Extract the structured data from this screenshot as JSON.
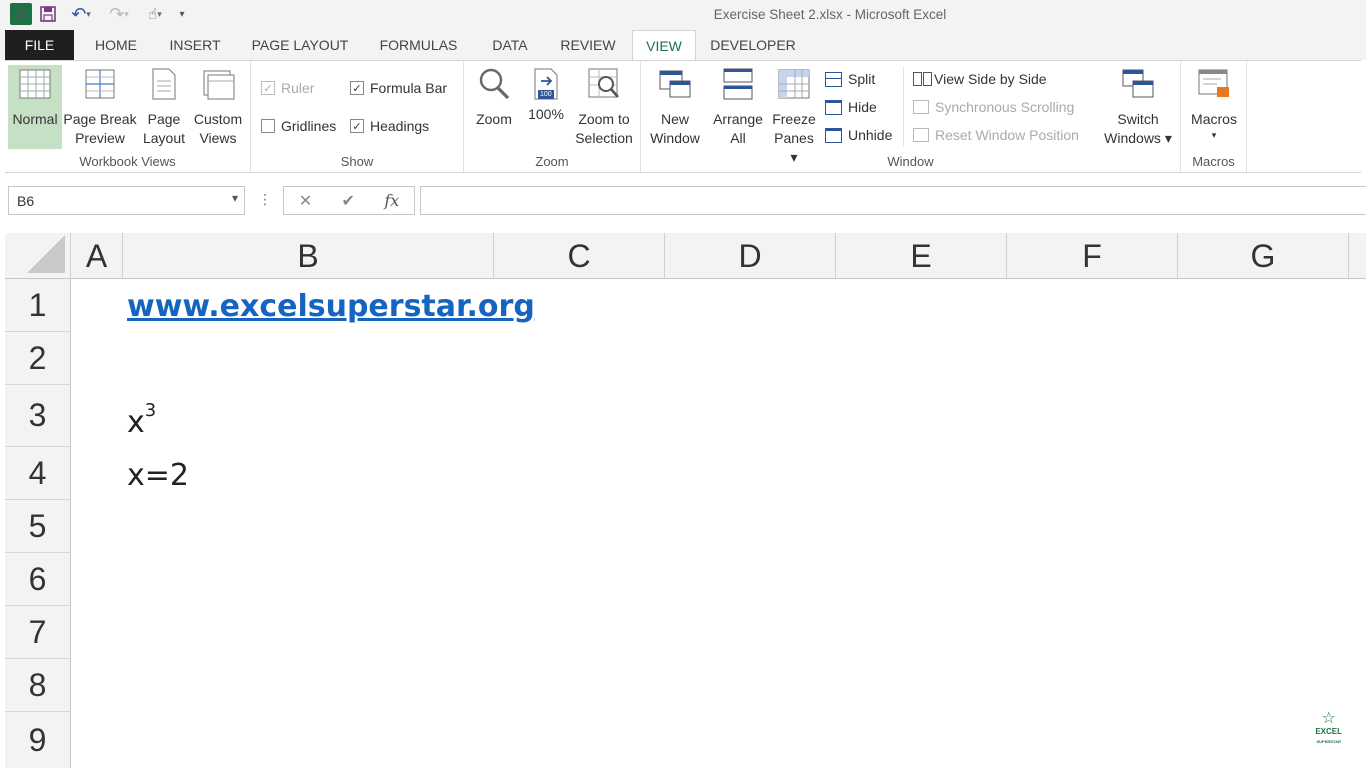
{
  "window": {
    "title": "Exercise Sheet 2.xlsx - Microsoft Excel"
  },
  "qat": {
    "logo": "X"
  },
  "tabs": [
    "FILE",
    "HOME",
    "INSERT",
    "PAGE LAYOUT",
    "FORMULAS",
    "DATA",
    "REVIEW",
    "VIEW",
    "DEVELOPER"
  ],
  "active_tab": "VIEW",
  "ribbon": {
    "workbook_views": {
      "label": "Workbook Views",
      "normal": "Normal",
      "page_break_1": "Page Break",
      "page_break_2": "Preview",
      "page_layout_1": "Page",
      "page_layout_2": "Layout",
      "custom_1": "Custom",
      "custom_2": "Views"
    },
    "show": {
      "label": "Show",
      "ruler": "Ruler",
      "formula_bar": "Formula Bar",
      "gridlines": "Gridlines",
      "headings": "Headings"
    },
    "zoom": {
      "label": "Zoom",
      "zoom": "Zoom",
      "hundred": "100%",
      "to_sel_1": "Zoom to",
      "to_sel_2": "Selection",
      "badge": "100"
    },
    "window": {
      "label": "Window",
      "new_1": "New",
      "new_2": "Window",
      "arrange_1": "Arrange",
      "arrange_2": "All",
      "freeze_1": "Freeze",
      "freeze_2": "Panes ▾",
      "split": "Split",
      "hide": "Hide",
      "unhide": "Unhide",
      "side_by_side": "View Side by Side",
      "sync_scroll": "Synchronous Scrolling",
      "reset_pos": "Reset Window Position",
      "switch_1": "Switch",
      "switch_2": "Windows ▾"
    },
    "macros": {
      "label": "Macros",
      "macros": "Macros",
      "arrow": "▾"
    }
  },
  "formula_bar": {
    "name_box": "B6",
    "value": ""
  },
  "columns": [
    "A",
    "B",
    "C",
    "D",
    "E",
    "F",
    "G"
  ],
  "rows": [
    "1",
    "2",
    "3",
    "4",
    "5",
    "6",
    "7",
    "8",
    "9"
  ],
  "cells": {
    "b1": "www.excelsuperstar.org",
    "b3_base": "x",
    "b3_sup": "3",
    "b4": "x=2"
  },
  "watermark": {
    "line1": "EXCEL",
    "line2": "SUPERSTAR"
  }
}
